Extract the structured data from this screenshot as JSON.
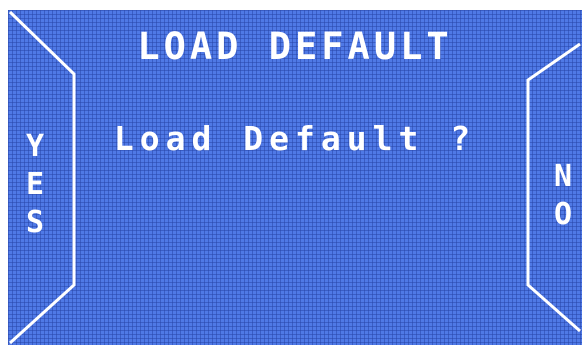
{
  "screen": {
    "title": "LOAD DEFAULT",
    "prompt": "Load Default ?"
  },
  "softkeys": {
    "yes": [
      "Y",
      "E",
      "S"
    ],
    "no": [
      "N",
      "O"
    ]
  },
  "colors": {
    "lcd_background": "#4f79e6",
    "lcd_grid": "#2846aa",
    "lcd_text": "#ffffff"
  }
}
